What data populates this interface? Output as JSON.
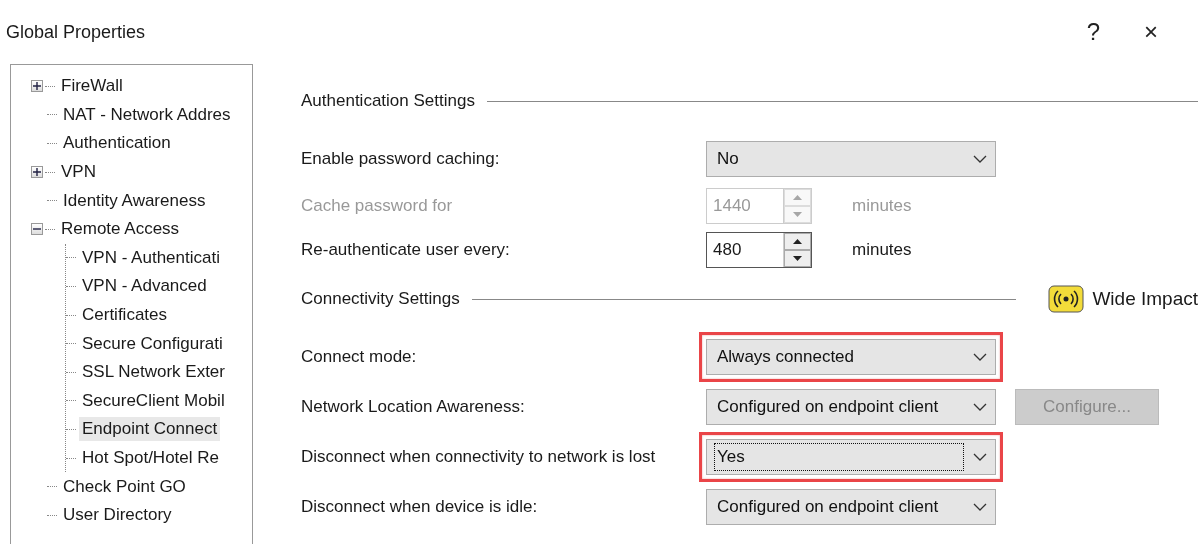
{
  "window": {
    "title": "Global Properties",
    "help": "?",
    "close": "×"
  },
  "tree": [
    {
      "label": "FireWall",
      "kind": "folder",
      "expanded": false,
      "selected": false
    },
    {
      "label": "NAT - Network Addres",
      "kind": "leaf",
      "selected": false
    },
    {
      "label": "Authentication",
      "kind": "leaf",
      "selected": false
    },
    {
      "label": "VPN",
      "kind": "folder",
      "expanded": false,
      "selected": false
    },
    {
      "label": "Identity Awareness",
      "kind": "leaf",
      "selected": false
    },
    {
      "label": "Remote Access",
      "kind": "folder",
      "expanded": true,
      "selected": false,
      "children": [
        {
          "label": "VPN - Authenticati",
          "selected": false
        },
        {
          "label": "VPN - Advanced",
          "selected": false
        },
        {
          "label": "Certificates",
          "selected": false
        },
        {
          "label": "Secure Configurati",
          "selected": false
        },
        {
          "label": "SSL Network Exter",
          "selected": false
        },
        {
          "label": "SecureClient Mobil",
          "selected": false
        },
        {
          "label": "Endpoint Connect",
          "selected": true
        },
        {
          "label": "Hot Spot/Hotel Re",
          "selected": false
        }
      ]
    },
    {
      "label": "Check Point GO",
      "kind": "leaf",
      "selected": false
    },
    {
      "label": "User Directory",
      "kind": "leaf",
      "selected": false
    }
  ],
  "sections": [
    {
      "title": "Authentication Settings",
      "rows": [
        {
          "label": "Enable password caching:",
          "kind": "select",
          "value": "No",
          "disabled": false,
          "highlighted": false,
          "focused": false
        },
        {
          "label": "Cache password for",
          "kind": "spinner",
          "value": "1440",
          "unit": "minutes",
          "disabled": true
        },
        {
          "label": "Re-authenticate user every:",
          "kind": "spinner",
          "value": "480",
          "unit": "minutes",
          "disabled": false
        }
      ]
    },
    {
      "title": "Connectivity Settings",
      "badge": {
        "label": "Wide Impact"
      },
      "rows": [
        {
          "label": "Connect mode:",
          "kind": "select",
          "value": "Always connected",
          "disabled": false,
          "highlighted": true,
          "focused": false
        },
        {
          "label": "Network Location Awareness:",
          "kind": "select",
          "value": "Configured on endpoint client",
          "disabled": false,
          "highlighted": false,
          "focused": false,
          "button": {
            "label": "Configure...",
            "disabled": true
          }
        },
        {
          "label": "Disconnect when connectivity to network is lost",
          "kind": "select",
          "value": "Yes",
          "disabled": false,
          "highlighted": true,
          "focused": true
        },
        {
          "label": "Disconnect when device is idle:",
          "kind": "select",
          "value": "Configured on endpoint client",
          "disabled": false,
          "highlighted": false,
          "focused": false
        }
      ]
    }
  ]
}
